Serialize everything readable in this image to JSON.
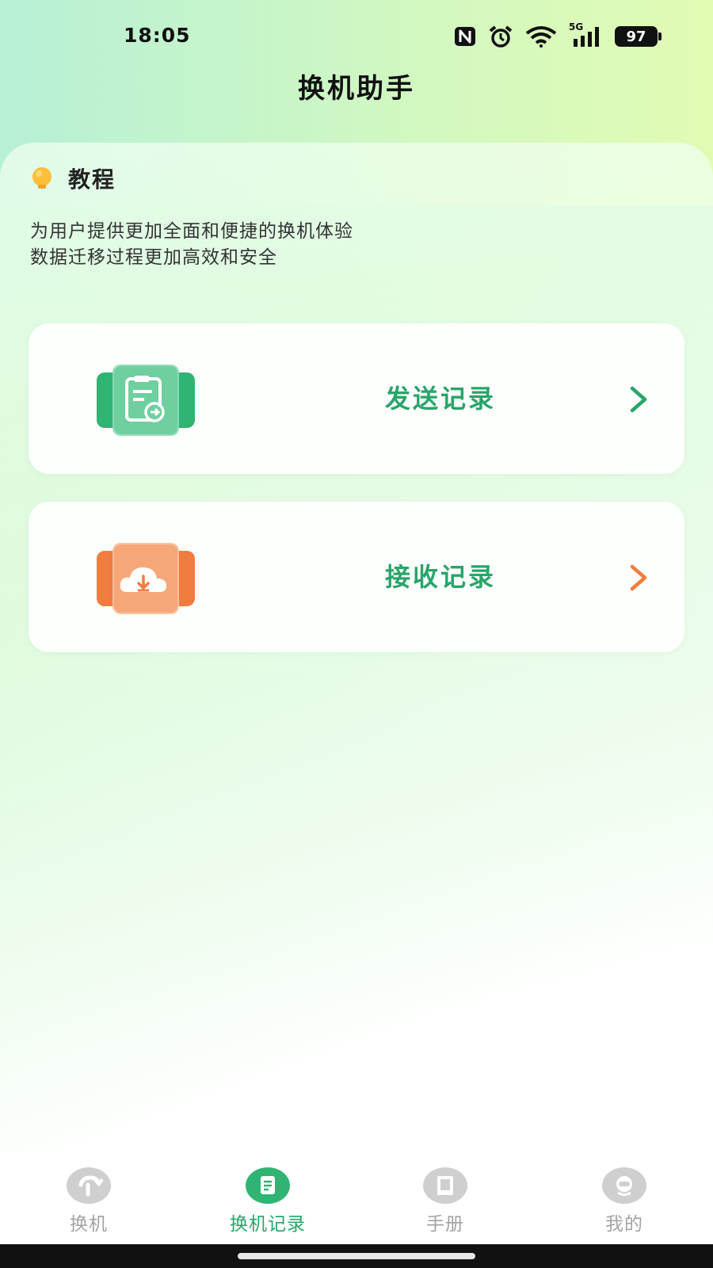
{
  "status_bar": {
    "time": "18:05",
    "network": "5G",
    "battery": "97",
    "icons": [
      "nfc-icon",
      "alarm-icon",
      "wifi-icon",
      "signal-icon",
      "battery-icon"
    ]
  },
  "header": {
    "title": "换机助手"
  },
  "tutorial": {
    "icon": "lightbulb-icon",
    "title": "教程",
    "line1": "为用户提供更加全面和便捷的换机体验",
    "line2": "数据迁移过程更加高效和安全"
  },
  "cards": [
    {
      "label": "发送记录",
      "icon": "send-record-icon",
      "accent": "#2aa46a",
      "chevron_color": "#2aa46a"
    },
    {
      "label": "接收记录",
      "icon": "cloud-download-icon",
      "accent": "#f07d3f",
      "chevron_color": "#f07d3f"
    }
  ],
  "bottom_nav": {
    "items": [
      {
        "label": "换机",
        "icon": "switch-phone-icon",
        "active": false
      },
      {
        "label": "换机记录",
        "icon": "record-icon",
        "active": true
      },
      {
        "label": "手册",
        "icon": "manual-icon",
        "active": false
      },
      {
        "label": "我的",
        "icon": "profile-icon",
        "active": false
      }
    ]
  },
  "colors": {
    "primary_green": "#2aa46a",
    "accent_orange": "#f07d3f",
    "inactive_gray": "#a3a3a3"
  }
}
